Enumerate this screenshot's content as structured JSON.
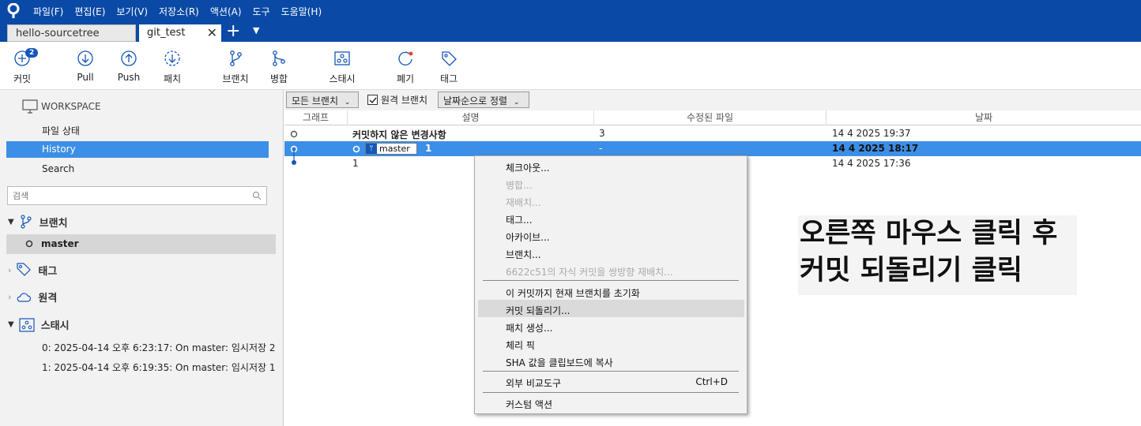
{
  "menubar": {
    "items": [
      "파일(F)",
      "편집(E)",
      "보기(V)",
      "저장소(R)",
      "액션(A)",
      "도구",
      "도움말(H)"
    ]
  },
  "tabs": [
    {
      "label": "hello-sourcetree"
    },
    {
      "label": "git_test"
    }
  ],
  "toolbar": {
    "commit_badge": "2",
    "buttons": [
      "커밋",
      "Pull",
      "Push",
      "패치",
      "브랜치",
      "병합",
      "스태시",
      "폐기",
      "태그"
    ]
  },
  "sidebar": {
    "workspace": "WORKSPACE",
    "items": [
      "파일 상태",
      "History",
      "Search"
    ],
    "search_placeholder": "검색",
    "branches": "브랜치",
    "master": "master",
    "tags": "태그",
    "remotes": "원격",
    "stashes": "스태시",
    "stash_list": [
      "0: 2025-04-14 오후 6:23:17: On master: 임시저장 2",
      "1: 2025-04-14 오후 6:19:35: On master: 임시저장 1"
    ]
  },
  "filter": {
    "branches_select": "모든 브랜치",
    "remote_check": "원격 브랜치",
    "sort_select": "날짜순으로 정렬"
  },
  "columns": [
    "그래프",
    "설명",
    "수정된 파일",
    "날짜"
  ],
  "commits": [
    {
      "desc": "커밋하지 않은 변경사항",
      "files": "3",
      "date": "14 4 2025 19:37"
    },
    {
      "branch": "master",
      "desc": "1",
      "files": "-",
      "date": "14 4 2025 18:17"
    },
    {
      "desc": "1",
      "files": "",
      "date": "14 4 2025 17:36"
    }
  ],
  "context_menu": {
    "items": [
      "체크아웃...",
      "병합...",
      "재배치...",
      "태그...",
      "아카이브...",
      "브랜치...",
      "6622c51의 자식 커밋을 쌍방향 재배치...",
      "이 커밋까지 현재 브랜치를 초기화",
      "커밋 되돌리기...",
      "패치 생성...",
      "체리 픽",
      "SHA 값을 클립보드에 복사",
      "외부 비교도구",
      "커스텀 액션"
    ],
    "shortcut": "Ctrl+D"
  },
  "annotation": {
    "line1": "오른쪽 마우스 클릭 후",
    "line2": "커밋 되돌리기 클릭"
  },
  "colors": {
    "titlebar": "#0a4aa6",
    "selection": "#3c8fe6",
    "badge": "#1457b8",
    "discard_dot": "#e8462e"
  }
}
